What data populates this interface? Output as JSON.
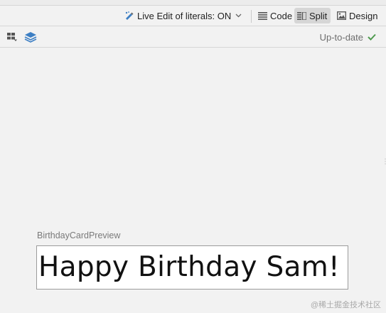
{
  "toolbar": {
    "live_edit": {
      "label": "Live Edit of literals: ON",
      "icon": "live-edit-icon",
      "dropdown_icon": "chevron-down-icon"
    },
    "modes": [
      {
        "label": "Code",
        "icon": "code-lines-icon",
        "selected": false
      },
      {
        "label": "Split",
        "icon": "split-view-icon",
        "selected": true
      },
      {
        "label": "Design",
        "icon": "image-icon",
        "selected": false
      }
    ]
  },
  "secondary_toolbar": {
    "device_icon": "device-configuration-icon",
    "layers_icon": "layers-icon",
    "status": "Up-to-date",
    "status_icon": "checkmark-icon"
  },
  "preview": {
    "name": "BirthdayCardPreview",
    "text": "Happy Birthday Sam!"
  },
  "watermark": "@稀土掘金技术社区",
  "colors": {
    "accent_blue": "#3d7fc4",
    "status_green": "#4f9a4f",
    "selected_mode_bg": "#d6d6d6",
    "canvas_bg": "#f2f2f2"
  }
}
